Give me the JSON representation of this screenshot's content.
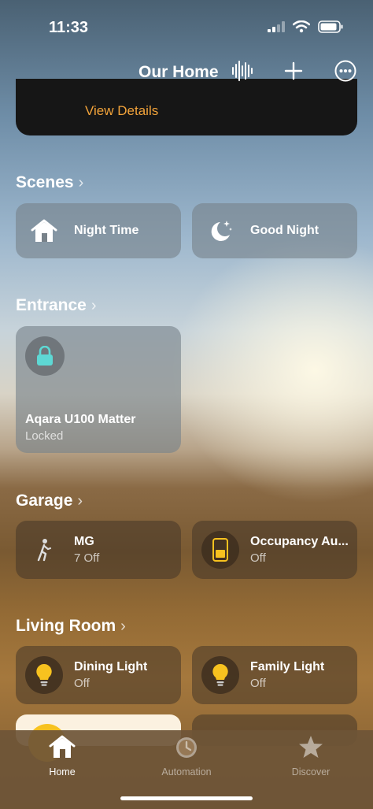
{
  "status": {
    "time": "11:33"
  },
  "header": {
    "title": "Our Home",
    "icons": [
      "waveform-icon",
      "plus-icon",
      "more-icon"
    ]
  },
  "top_card": {
    "link": "View Details"
  },
  "sections": {
    "scenes": {
      "title": "Scenes"
    },
    "entrance": {
      "title": "Entrance"
    },
    "garage": {
      "title": "Garage"
    },
    "living_room": {
      "title": "Living Room"
    }
  },
  "scenes": [
    {
      "label": "Night Time",
      "icon": "home-icon"
    },
    {
      "label": "Good Night",
      "icon": "moon-stars-icon"
    }
  ],
  "entrance": {
    "lock": {
      "name": "Aqara U100 Matter",
      "status": "Locked",
      "icon": "lock-icon"
    }
  },
  "garage": [
    {
      "name": "MG",
      "status": "7 Off",
      "icon": "walking-person-icon"
    },
    {
      "name": "Occupancy Au...",
      "status": "Off",
      "icon": "occupancy-sensor-icon"
    }
  ],
  "living_room": [
    {
      "name": "Dining Light",
      "status": "Off",
      "icon": "lightbulb-icon"
    },
    {
      "name": "Family Light",
      "status": "Off",
      "icon": "lightbulb-icon"
    }
  ],
  "tabs": [
    {
      "label": "Home",
      "active": true,
      "icon": "house-icon"
    },
    {
      "label": "Automation",
      "active": false,
      "icon": "clock-icon"
    },
    {
      "label": "Discover",
      "active": false,
      "icon": "star-icon"
    }
  ],
  "colors": {
    "accent_orange": "#f2a33a",
    "lock_teal": "#5ed8d4",
    "bulb_yellow": "#f7c21f"
  }
}
